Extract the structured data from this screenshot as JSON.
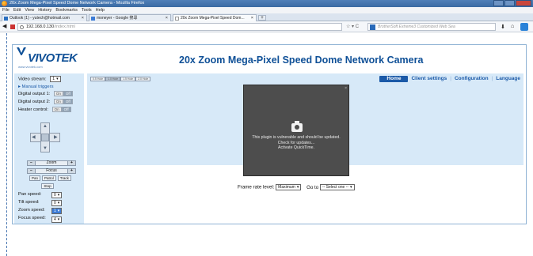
{
  "browser": {
    "window_title": "20x Zoom Mega-Pixel Speed Dome Network Camera - Mozilla Firefox",
    "menu": [
      "File",
      "Edit",
      "View",
      "History",
      "Bookmarks",
      "Tools",
      "Help"
    ],
    "tabs": [
      {
        "label": "Outlook (1) - yutech@hotmail.com"
      },
      {
        "label": "moneyer - Google 搜尋"
      },
      {
        "label": "20x Zoom Mega-Pixel Speed Dom..."
      }
    ],
    "url_host": "192.168.0.130",
    "url_path": "/index.html",
    "search_placeholder": "BrotherSoft Extreme3 Customized Web Sea"
  },
  "camera": {
    "brand": "VIVOTEK",
    "brand_sub": "www.vivotek.com",
    "title": "20x Zoom Mega-Pixel Speed Dome Network Camera",
    "top_menu": {
      "home": "Home",
      "client_settings": "Client settings",
      "configuration": "Configuration",
      "language": "Language"
    },
    "resolution_buttons": [
      "0.5 Hole",
      "1.0 Hole",
      "1.5 Hole",
      "2.0 Hole"
    ],
    "sidebar": {
      "video_stream_label": "Video stream:",
      "video_stream_value": "1",
      "manual_triggers": "Manual triggers",
      "digital_output1": "Digital output 1:",
      "digital_output2": "Digital output 2:",
      "heater_control": "Heater control:",
      "on": "On",
      "off": "Off",
      "zoom": "Zoom",
      "focus": "Focus",
      "pan": "Pan",
      "patrol": "Patrol",
      "track": "Track",
      "stop": "Stop",
      "pan_speed": "Pan speed:",
      "pan_speed_value": "0",
      "tilt_speed": "Tilt speed:",
      "tilt_speed_value": "0",
      "zoom_speed": "Zoom speed:",
      "zoom_speed_value": "1",
      "focus_speed": "Focus speed:",
      "focus_speed_value": "4"
    },
    "plugin_message": [
      "This plugin is vulnerable and should be updated.",
      "Check for updates...",
      "Activate QuickTime."
    ],
    "frame_rate_label": "Frame rate level:",
    "frame_rate_value": "Maximum",
    "goto_label": "Go to",
    "goto_value": "-- Select one --"
  }
}
